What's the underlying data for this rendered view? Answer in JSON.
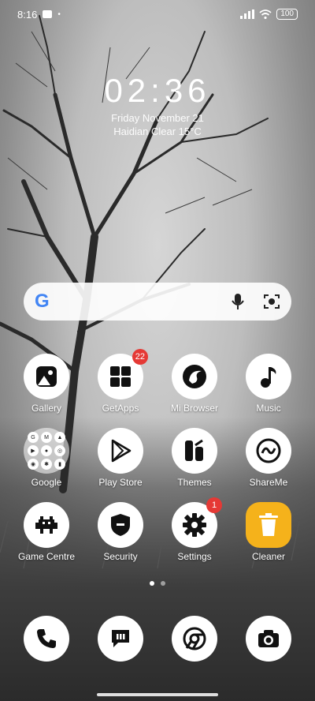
{
  "status": {
    "time": "8:16",
    "battery": "100"
  },
  "clock": {
    "time": "02:36",
    "date": "Friday November 21",
    "weather": "Haidian Clear 15°C"
  },
  "search": {
    "brand": "G"
  },
  "apps": [
    {
      "label": "Gallery"
    },
    {
      "label": "GetApps",
      "badge": "22"
    },
    {
      "label": "Mi Browser"
    },
    {
      "label": "Music"
    },
    {
      "label": "Google"
    },
    {
      "label": "Play Store"
    },
    {
      "label": "Themes"
    },
    {
      "label": "ShareMe"
    },
    {
      "label": "Game Centre"
    },
    {
      "label": "Security"
    },
    {
      "label": "Settings",
      "badge": "1"
    },
    {
      "label": "Cleaner"
    }
  ],
  "dock": [
    "phone-icon",
    "messages-icon",
    "chrome-icon",
    "camera-icon"
  ],
  "colors": {
    "badge": "#e53935",
    "cleaner": "#f5b21b"
  }
}
